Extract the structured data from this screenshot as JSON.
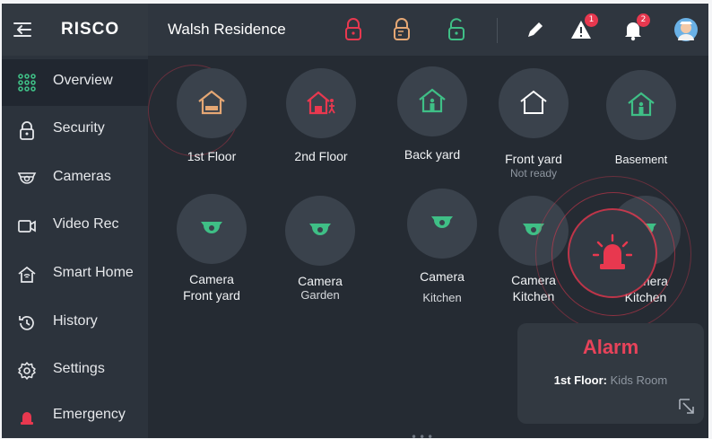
{
  "app": {
    "logo": "RISCO",
    "site_name": "Walsh Residence",
    "notification_badges": {
      "alerts": "1",
      "bell": "2"
    }
  },
  "sidebar": {
    "items": [
      {
        "label": "Overview",
        "icon": "grid-icon",
        "active": true
      },
      {
        "label": "Security",
        "icon": "lock-icon"
      },
      {
        "label": "Cameras",
        "icon": "camera-icon"
      },
      {
        "label": "Video Rec",
        "icon": "video-icon"
      },
      {
        "label": "Smart Home",
        "icon": "smart-home-icon"
      },
      {
        "label": "History",
        "icon": "history-icon"
      },
      {
        "label": "Settings",
        "icon": "gear-icon"
      },
      {
        "label": "Emergency",
        "icon": "siren-icon"
      }
    ]
  },
  "partitions": [
    {
      "name": "1st Floor",
      "status": "",
      "icon": "house-bed-icon"
    },
    {
      "name": "2nd Floor",
      "status": "",
      "icon": "house-person-icon"
    },
    {
      "name": "Back yard",
      "status": "",
      "icon": "house-person-icon"
    },
    {
      "name": "Front yard",
      "status": "Not ready",
      "icon": "house-icon"
    },
    {
      "name": "Basement",
      "status": "",
      "icon": "house-person-icon"
    }
  ],
  "cameras": [
    {
      "line1": "Camera",
      "line2": "Front yard"
    },
    {
      "line1": "Camera",
      "line2": "Garden"
    },
    {
      "line1": "Camera",
      "line2": "Kitchen"
    },
    {
      "line1": "Camera",
      "line2": "Kitchen"
    },
    {
      "line1": "Camera",
      "line2": "Kitchen"
    }
  ],
  "alarm": {
    "title": "Alarm",
    "partition": "1st Floor:",
    "zone": "Kids Room"
  },
  "colors": {
    "alarm_red": "#e8384f",
    "armed_orange": "#e5a774",
    "disarmed_green": "#3fbf86"
  }
}
